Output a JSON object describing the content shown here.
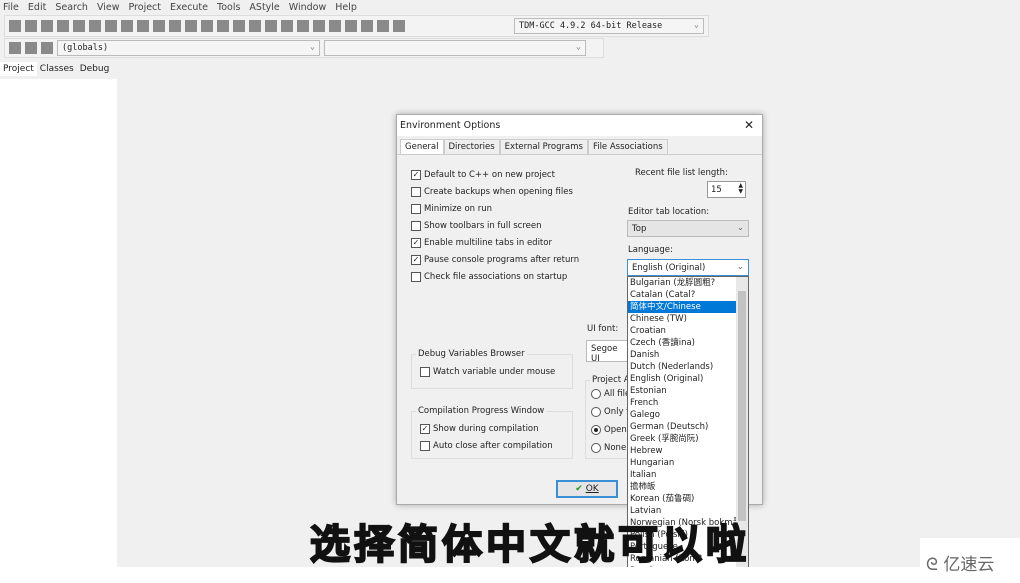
{
  "menu": [
    "File",
    "Edit",
    "Search",
    "View",
    "Project",
    "Execute",
    "Tools",
    "AStyle",
    "Window",
    "Help"
  ],
  "toolbar": {
    "compiler": "TDM-GCC 4.9.2 64-bit Release",
    "scope": "(globals)"
  },
  "left_tabs": [
    "Project",
    "Classes",
    "Debug"
  ],
  "dialog": {
    "title": "Environment Options",
    "tabs": [
      "General",
      "Directories",
      "External Programs",
      "File Associations"
    ],
    "checkboxes": [
      {
        "label": "Default to C++ on new project",
        "checked": true
      },
      {
        "label": "Create backups when opening files",
        "checked": false
      },
      {
        "label": "Minimize on run",
        "checked": false
      },
      {
        "label": "Show toolbars in full screen",
        "checked": false
      },
      {
        "label": "Enable multiline tabs in editor",
        "checked": true
      },
      {
        "label": "Pause console programs after return",
        "checked": true
      },
      {
        "label": "Check file associations on startup",
        "checked": false
      }
    ],
    "recent_label": "Recent file list length:",
    "recent_value": "15",
    "tab_location_label": "Editor tab location:",
    "tab_location_value": "Top",
    "language_label": "Language:",
    "language_value": "English (Original)",
    "ui_font_label": "UI font:",
    "ui_font_value": "Segoe UI",
    "debug_group": "Debug Variables Browser",
    "debug_watch": "Watch variable under mouse",
    "compile_group": "Compilation Progress Window",
    "compile_show": "Show during compilation",
    "compile_autoclose": "Auto close after compilation",
    "project_group": "Project A",
    "radios": [
      {
        "label": "All file",
        "on": false
      },
      {
        "label": "Only f",
        "on": false
      },
      {
        "label": "Open",
        "on": true
      },
      {
        "label": "None",
        "on": false
      }
    ],
    "ok": "OK"
  },
  "languages": [
    "Bulgarian (龙脬圆粗?",
    "Catalan (Catal?",
    "简体中文/Chinese",
    "Chinese (TW)",
    "Croatian",
    "Czech (香讀ina)",
    "Danish",
    "Dutch (Nederlands)",
    "English (Original)",
    "Estonian",
    "French",
    "Galego",
    "German (Deutsch)",
    "Greek (孚腕尚阮)",
    "Hebrew",
    "Hungarian",
    "Italian",
    "擔柿皈",
    "Korean (茄鲁碉)",
    "Latvian",
    "Norwegian (Norsk bokmål)",
    "Polish (Polski)",
    "Portuguese",
    "Romanian (Rom?",
    "Russian"
  ],
  "selected_language_index": 2,
  "subtitle": "选择简体中文就可以啦",
  "watermark": "亿速云"
}
